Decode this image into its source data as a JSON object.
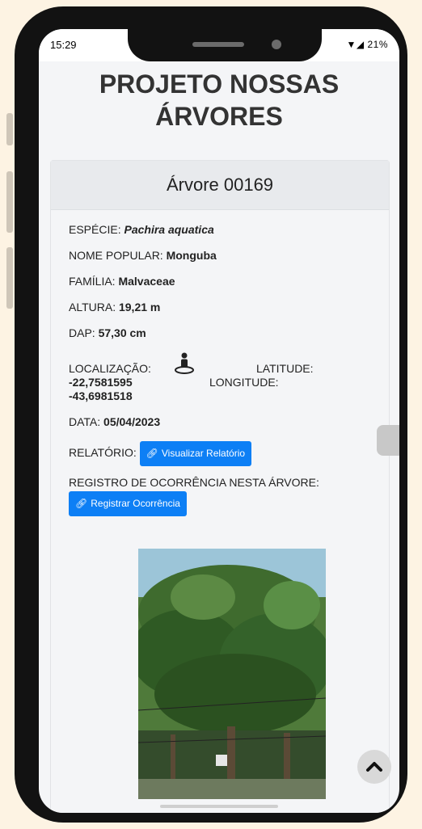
{
  "status": {
    "time": "15:29",
    "indicators": "▼◢ 21%"
  },
  "page": {
    "title": "PROJETO NOSSAS ÁRVORES"
  },
  "card": {
    "header": "Árvore 00169",
    "especie_label": "ESPÉCIE:",
    "especie_value": "Pachira aquatica",
    "nome_label": "NOME POPULAR:",
    "nome_value": "Monguba",
    "familia_label": "FAMÍLIA:",
    "familia_value": "Malvaceae",
    "altura_label": "ALTURA:",
    "altura_value": "19,21 m",
    "dap_label": "DAP:",
    "dap_value": "57,30 cm",
    "localizacao_label": "LOCALIZAÇÃO:",
    "latitude_label": "LATITUDE:",
    "latitude_value": "-22,7581595",
    "longitude_label": "LONGITUDE:",
    "longitude_value": "-43,6981518",
    "data_label": "DATA:",
    "data_value": "05/04/2023",
    "relatorio_label": "RELATÓRIO:",
    "relatorio_button": "Visualizar Relatório",
    "registro_label": "REGISTRO DE OCORRÊNCIA NESTA ÁRVORE:",
    "registro_button": "Registrar Ocorrência"
  },
  "icons": {
    "link": "link-icon",
    "location": "person-pin-icon",
    "back_to_top": "chevron-up-icon"
  },
  "colors": {
    "primary_button": "#0d7ff5",
    "background": "#fdf3e3"
  }
}
